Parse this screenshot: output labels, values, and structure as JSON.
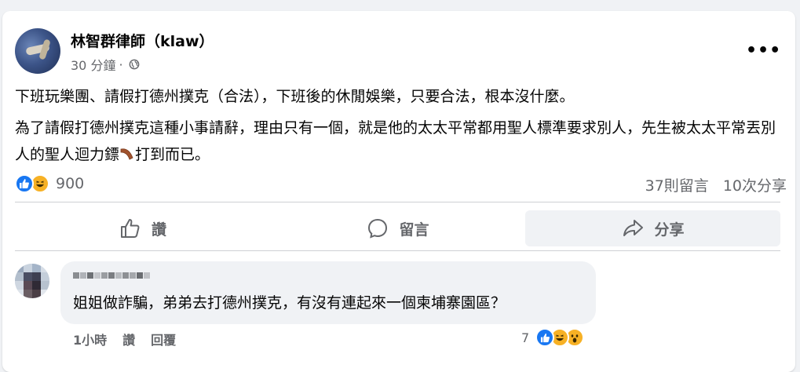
{
  "post": {
    "author": "林智群律師（klaw）",
    "time": "30 分鐘",
    "separator": "·",
    "more_label": "•••",
    "paragraph1": "下班玩樂團、請假打德州撲克（合法），下班後的休閒娛樂，只要合法，根本沒什麼。",
    "paragraph2_a": "為了請假打德州撲克這種小事請辭，理由只有一個，就是他的太太平常都用聖人標準要求別人，先生被太太平常丟別人的聖人迴力鏢",
    "paragraph2_b": "打到而已。",
    "reaction_count": "900",
    "comments_count": "37則留言",
    "shares_count": "10次分享",
    "reaction_icons": [
      "like-icon",
      "haha-icon"
    ]
  },
  "actions": {
    "like": "讚",
    "comment": "留言",
    "share": "分享"
  },
  "comment": {
    "text": "姐姐做詐騙，弟弟去打德州撲克，有沒有連起來一個柬埔寨園區？",
    "time": "1小時",
    "like": "讚",
    "reply": "回覆",
    "reaction_count": "7",
    "reaction_icons": [
      "like-icon",
      "haha-icon",
      "wow-icon"
    ]
  },
  "colors": {
    "accent": "#1877f2",
    "secondary_text": "#65676b",
    "haha": "#f7b125"
  }
}
